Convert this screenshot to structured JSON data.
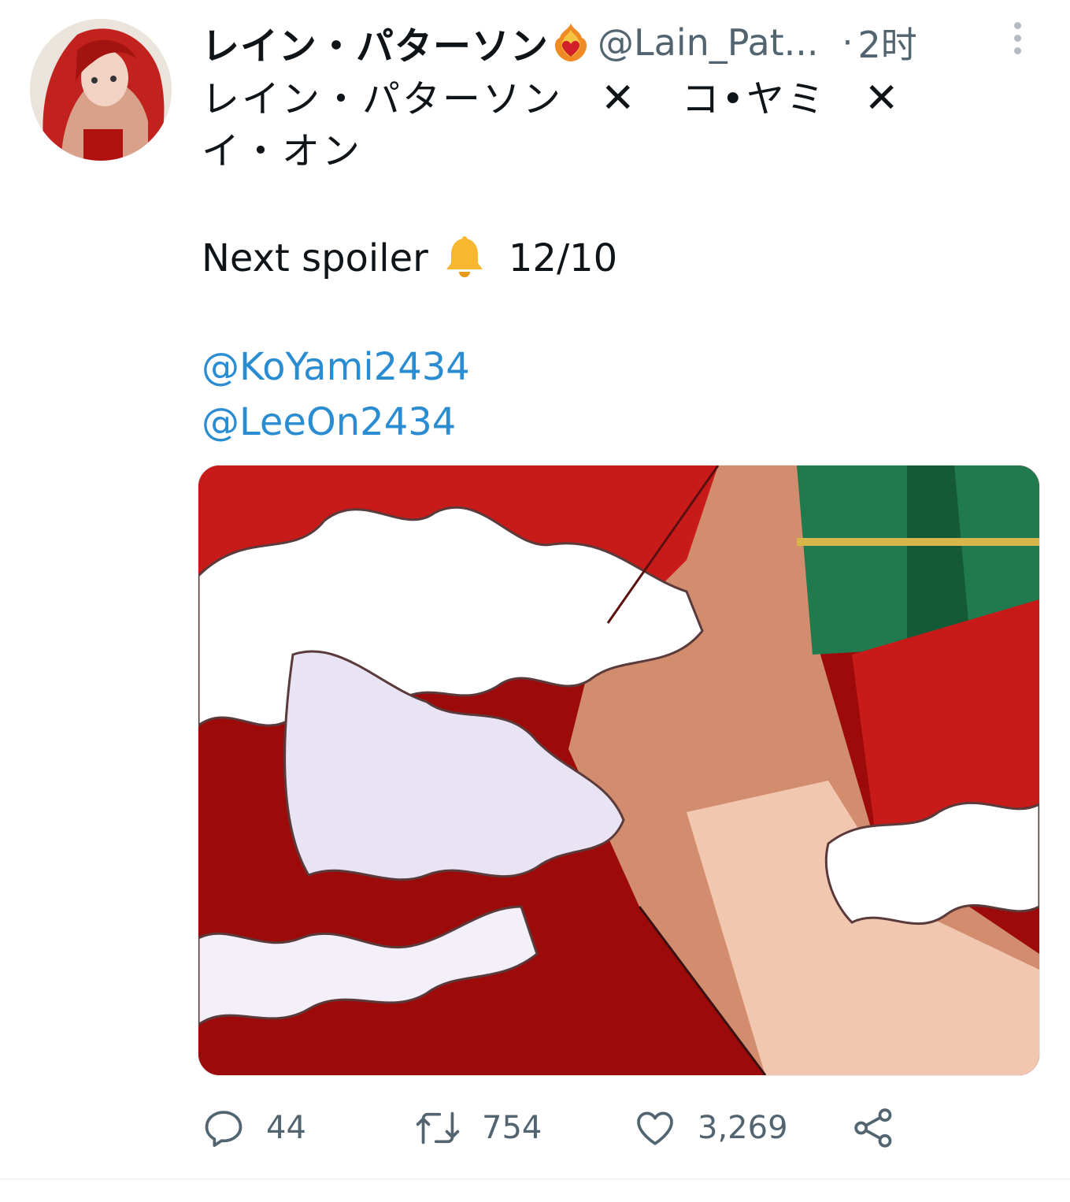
{
  "tweet": {
    "display_name": "レイン・パターソン",
    "handle": "@Lain_Pat...",
    "separator": "·",
    "time": "2时",
    "title_parts": [
      "レイン・パターソン",
      "✕",
      "コ•ヤミ",
      "✕",
      "イ・オン"
    ],
    "spoiler_label": "Next spoiler",
    "spoiler_date": "12/10",
    "mentions": [
      "@KoYami2434",
      "@LeeOn2434"
    ]
  },
  "actions": {
    "replies": "44",
    "retweets": "754",
    "likes": "3,269"
  },
  "colors": {
    "text": "#0f1419",
    "secondary": "#536471",
    "link": "#2a8cd1",
    "icon": "#536471",
    "bell": "#f7b731"
  },
  "icons": {
    "badge": "heart-fire-icon",
    "bell": "bell-icon",
    "more": "more-vertical-icon",
    "reply": "reply-icon",
    "retweet": "retweet-icon",
    "like": "heart-icon",
    "share": "share-icon"
  }
}
